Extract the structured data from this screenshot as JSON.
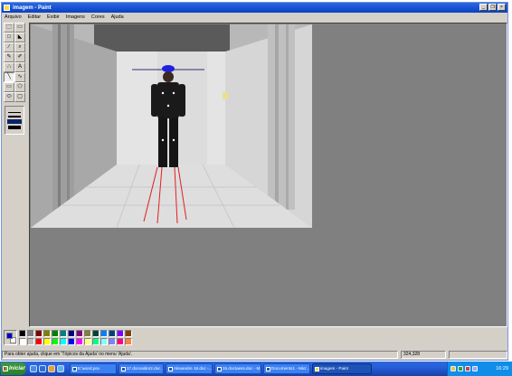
{
  "window": {
    "title": "imagem - Paint",
    "buttons": [
      "_",
      "×"
    ],
    "restore_button": "❐"
  },
  "menu": [
    "Arquivo",
    "Editar",
    "Exibir",
    "Imagens",
    "Cores",
    "Ajuda"
  ],
  "tools": [
    {
      "name": "free-form-select",
      "glyph": "⬚"
    },
    {
      "name": "rect-select",
      "glyph": "▭"
    },
    {
      "name": "eraser",
      "glyph": "□"
    },
    {
      "name": "fill",
      "glyph": "◣"
    },
    {
      "name": "color-picker",
      "glyph": "∕"
    },
    {
      "name": "magnifier",
      "glyph": "⌕"
    },
    {
      "name": "pencil",
      "glyph": "✎"
    },
    {
      "name": "brush",
      "glyph": "✐"
    },
    {
      "name": "airbrush",
      "glyph": "∴"
    },
    {
      "name": "text",
      "glyph": "A"
    },
    {
      "name": "line",
      "glyph": "╲"
    },
    {
      "name": "curve",
      "glyph": "∿"
    },
    {
      "name": "rectangle",
      "glyph": "▭"
    },
    {
      "name": "polygon",
      "glyph": "⬠"
    },
    {
      "name": "ellipse",
      "glyph": "⬭"
    },
    {
      "name": "rounded-rect",
      "glyph": "▢"
    }
  ],
  "palette": {
    "foreground": "#0000c8",
    "background": "#ffffff",
    "colors": [
      "#000000",
      "#808080",
      "#800000",
      "#808000",
      "#008000",
      "#008080",
      "#000080",
      "#800080",
      "#808040",
      "#004040",
      "#0080ff",
      "#004080",
      "#8000ff",
      "#804000",
      "#ffffff",
      "#c0c0c0",
      "#ff0000",
      "#ffff00",
      "#00ff00",
      "#00ffff",
      "#0000ff",
      "#ff00ff",
      "#ffff80",
      "#00ff80",
      "#80ffff",
      "#8080ff",
      "#ff0080",
      "#ff8040"
    ]
  },
  "status": {
    "help": "Para obter ajuda, clique em 'Tópicos da Ajuda' no menu 'Ajuda'.",
    "coords": "324,328"
  },
  "taskbar": {
    "start_label": "Iniciar",
    "tasks": [
      {
        "label": "E:\\word.psx",
        "active": false
      },
      {
        "label": "17.docvaldor2.doc ...",
        "active": false
      },
      {
        "label": "Alexandre 18.doc -...",
        "active": false
      },
      {
        "label": "15.doctaess.doc - M...",
        "active": false
      },
      {
        "label": "Documento1 - Micr...",
        "active": false
      },
      {
        "label": "imagem - Paint",
        "active": true
      }
    ],
    "clock": "16:29"
  }
}
